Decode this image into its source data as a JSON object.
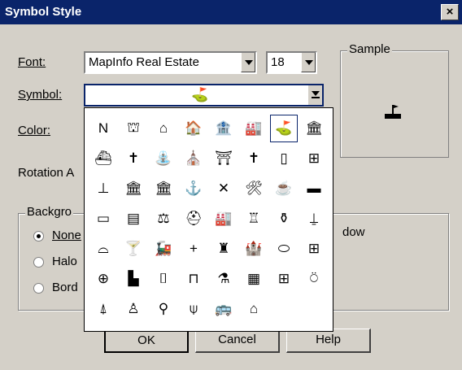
{
  "dialog": {
    "title": "Symbol Style",
    "close_label": "×"
  },
  "labels": {
    "font": "Font:",
    "symbol": "Symbol:",
    "color": "Color:",
    "rotation": "Rotation A"
  },
  "font_select": {
    "value": "MapInfo Real Estate"
  },
  "size_select": {
    "value": "18"
  },
  "sample": {
    "label": "Sample"
  },
  "background": {
    "label": "Backgro",
    "options": [
      {
        "label": "None",
        "checked": true
      },
      {
        "label": "Halo",
        "checked": false
      },
      {
        "label": "Bord",
        "checked": false
      }
    ],
    "shadow_tail": "dow"
  },
  "buttons": {
    "ok": "OK",
    "cancel": "Cancel",
    "help": "Help"
  },
  "symbols": [
    [
      "N",
      "⛫",
      "⌂",
      "🏠",
      "🏦",
      "🏭",
      "⛳",
      "🏛"
    ],
    [
      "⛴",
      "✝",
      "⛲",
      "⛪",
      "⛩",
      "✝",
      "▯",
      "⊞"
    ],
    [
      "⊥",
      "🏛",
      "🏛",
      "⚓",
      "✕",
      "🛠",
      "☕",
      "▬"
    ],
    [
      "▭",
      "▤",
      "⚖",
      "⛑",
      "🏭",
      "♖",
      "⚱",
      "⍊"
    ],
    [
      "⌓",
      "🍸",
      "🚂",
      "+",
      "♜",
      "🏰",
      "⬭",
      "⊞"
    ],
    [
      "⊕",
      "▙",
      "⌷",
      "⊓",
      "⚗",
      "▦",
      "⊞",
      "⍥"
    ],
    [
      "⍋",
      "♙",
      "⚲",
      "⍦",
      "🚌",
      "⌂"
    ]
  ],
  "selected_symbol_index": [
    0,
    6
  ]
}
